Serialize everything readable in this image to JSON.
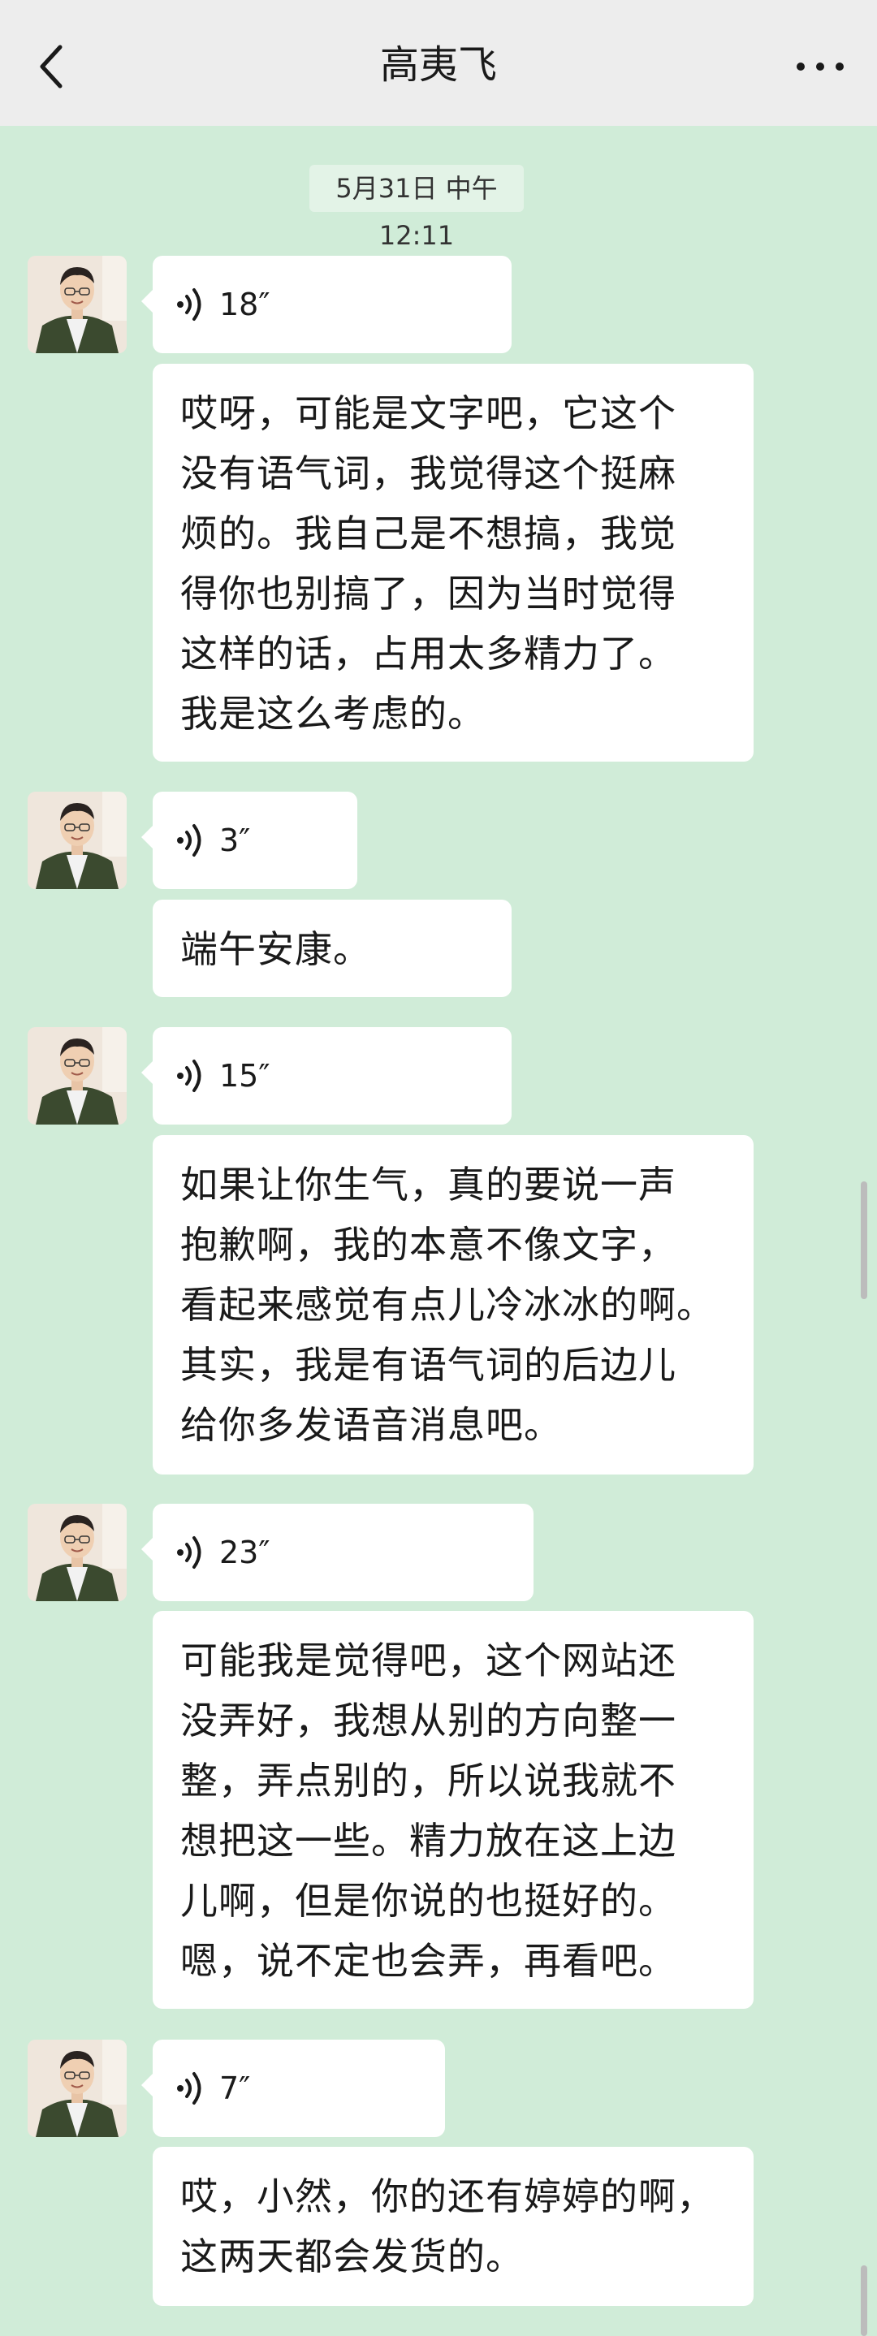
{
  "header": {
    "title": "高夷飞"
  },
  "timestamp": "5月31日 中午12:11",
  "messages": [
    {
      "voice": "18″",
      "text": [
        "哎呀，可能是文字吧，它这个",
        "没有语气词，我觉得这个挺麻",
        "烦的。我自己是不想搞，我觉",
        "得你也别搞了，因为当时觉得",
        "这样的话，占用太多精力了。",
        "我是这么考虑的。"
      ]
    },
    {
      "voice": "3″",
      "text": [
        "端午安康。"
      ]
    },
    {
      "voice": "15″",
      "text": [
        "如果让你生气，真的要说一声",
        "抱歉啊，我的本意不像文字，",
        "看起来感觉有点儿冷冰冰的啊。",
        "其实，我是有语气词的后边儿",
        "给你多发语音消息吧。"
      ]
    },
    {
      "voice": "23″",
      "text": [
        "可能我是觉得吧，这个网站还",
        "没弄好，我想从别的方向整一",
        "整，弄点别的，所以说我就不",
        "想把这一些。精力放在这上边",
        "儿啊，但是你说的也挺好的。",
        "嗯，说不定也会弄，再看吧。"
      ]
    },
    {
      "voice": "7″",
      "text": [
        "哎，小然，你的还有婷婷的啊，",
        "这两天都会发货的。"
      ]
    }
  ]
}
